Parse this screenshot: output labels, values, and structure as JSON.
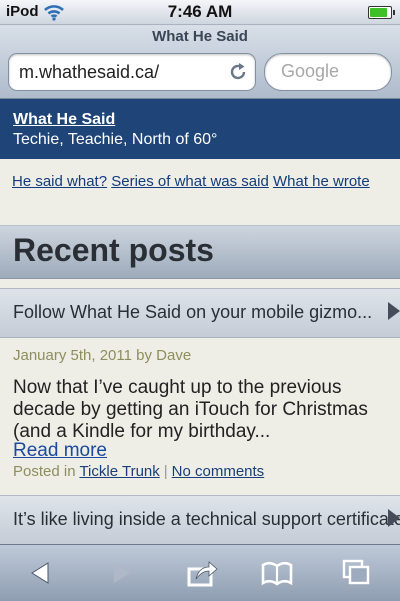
{
  "status_bar": {
    "carrier": "iPod",
    "time": "7:46 AM",
    "battery_level": 0.85,
    "wifi_icon": "wifi-icon",
    "battery_icon": "battery-icon"
  },
  "browser": {
    "page_title": "What He Said",
    "url": "m.whathesaid.ca/",
    "search_placeholder": "Google",
    "reload_icon": "reload-icon"
  },
  "site": {
    "name": "What He Said",
    "tagline": "Techie, Teachie, North of 60°"
  },
  "nav": {
    "links": [
      "He said what?",
      "Series of what was said",
      "What he wrote"
    ]
  },
  "main": {
    "heading": "Recent posts",
    "posts": [
      {
        "title": "Follow What He Said on your mobile gizmo..."
      },
      {
        "date": "January 5th, 2011",
        "by_label": "by",
        "author": "Dave",
        "excerpt": "Now that I’ve caught up to the previous decade by getting an iTouch for Christmas (and a Kindle for my birthday...",
        "read_more": "Read more",
        "posted_in_label": "Posted in",
        "category": "Tickle Trunk",
        "comments": "No comments"
      },
      {
        "title": "It’s like living inside a technical support certificate..."
      }
    ]
  },
  "toolbar": {
    "buttons": [
      "back-icon",
      "forward-icon",
      "share-icon",
      "bookmarks-icon",
      "tabs-icon"
    ]
  },
  "colors": {
    "header_bg": "#1e4478",
    "link": "#123c7c",
    "meta": "#8c8e5e",
    "page_bg": "#eeeee6"
  }
}
